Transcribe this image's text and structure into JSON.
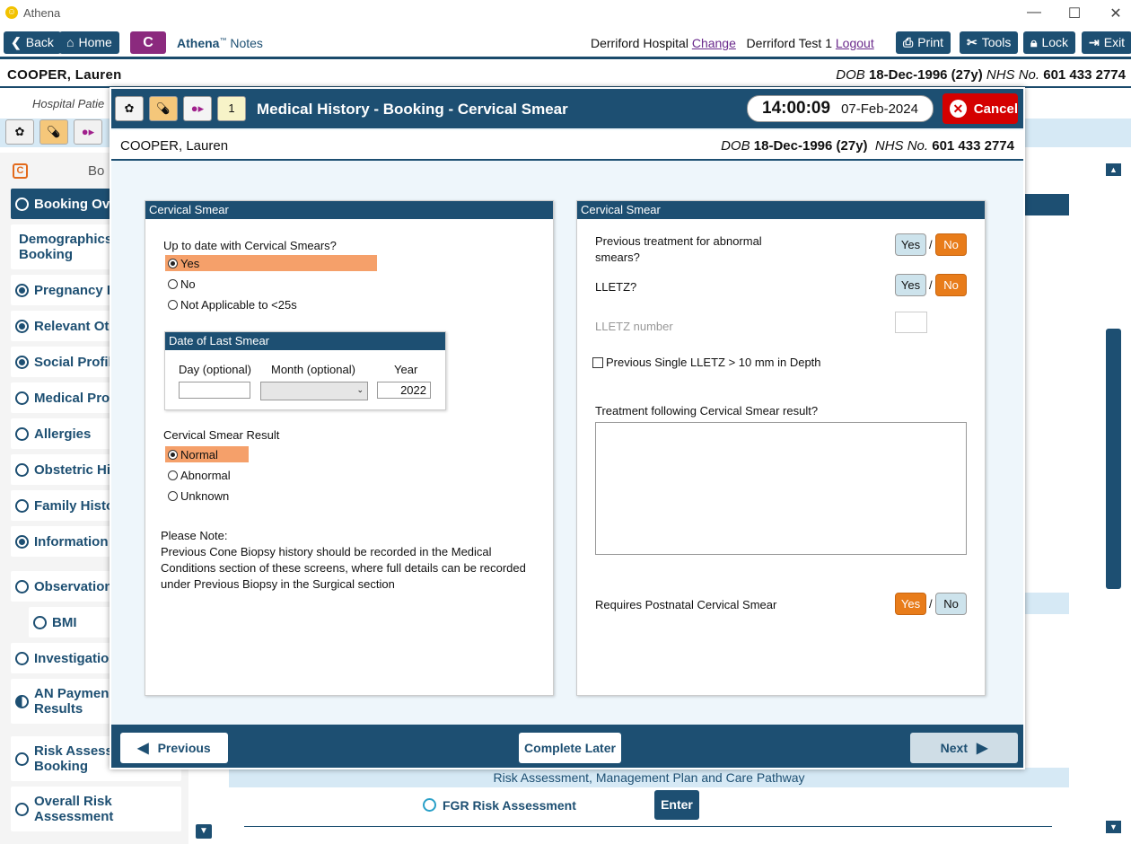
{
  "window": {
    "title": "Athena",
    "logo_glyph": "☺"
  },
  "toolbar": {
    "back": "Back",
    "home": "Home",
    "c_label": "C",
    "app_name": "Athena",
    "app_tm": "™",
    "app_sub": "Notes",
    "hospital": "Derriford Hospital",
    "change": "Change",
    "user": "Derriford Test 1",
    "logout": "Logout",
    "print": "Print",
    "tools": "Tools",
    "lock": "Lock",
    "exit": "Exit"
  },
  "patient": {
    "name": "COOPER, Lauren",
    "dob_label": "DOB",
    "dob": "18-Dec-1996 (27y)",
    "nhs_label": "NHS No.",
    "nhs": "601 433 2774"
  },
  "subbar": {
    "text": "Hospital Patie"
  },
  "sidebar": {
    "c_icon": "C",
    "header_partial": "Bo",
    "items": [
      {
        "label": "Booking Ov",
        "state": "empty"
      },
      {
        "label": "Demographics Booking",
        "state": "none"
      },
      {
        "label": "Pregnancy F",
        "state": "filled"
      },
      {
        "label": "Relevant Oth",
        "state": "filled"
      },
      {
        "label": "Social Profil",
        "state": "filled"
      },
      {
        "label": "Medical Pro",
        "state": "empty"
      },
      {
        "label": "Allergies",
        "state": "empty"
      },
      {
        "label": "Obstetric Hi",
        "state": "empty"
      },
      {
        "label": "Family Histo",
        "state": "empty"
      },
      {
        "label": "Information",
        "state": "filled"
      },
      {
        "label": "Observation",
        "state": "empty"
      },
      {
        "label": "BMI",
        "state": "empty"
      },
      {
        "label": "Investigatio",
        "state": "empty"
      },
      {
        "label": "AN Paymen Results",
        "state": "half"
      },
      {
        "label": "Risk Assess Booking",
        "state": "empty"
      },
      {
        "label": "Overall Risk Assessment",
        "state": "empty"
      }
    ]
  },
  "main": {
    "risk_header": "Risk Assessment, Management Plan and Care Pathway",
    "fgr": "FGR Risk Assessment",
    "enter": "Enter"
  },
  "modal": {
    "title": "Medical History - Booking - Cervical Smear",
    "time": "14:00:09",
    "date": "07-Feb-2024",
    "cancel": "Cancel",
    "cal_icon": "1",
    "left": {
      "header": "Cervical Smear",
      "q1": "Up to date with Cervical Smears?",
      "q1_options": [
        "Yes",
        "No",
        "Not Applicable to <25s"
      ],
      "q1_selected": "Yes",
      "date_header": "Date of Last Smear",
      "day_label": "Day (optional)",
      "month_label": "Month (optional)",
      "year_label": "Year",
      "day_value": "",
      "month_value": "",
      "year_value": "2022",
      "result_label": "Cervical Smear Result",
      "result_options": [
        "Normal",
        "Abnormal",
        "Unknown"
      ],
      "result_selected": "Normal",
      "note_title": "Please Note:",
      "note_lines": [
        "Previous Cone Biopsy history should be recorded in the Medical",
        "Conditions section of these screens, where full details can be recorded",
        "under Previous Biopsy in the Surgical section"
      ]
    },
    "right": {
      "header": "Cervical Smear",
      "prev_treatment_l1": "Previous treatment for abnormal",
      "prev_treatment_l2": "smears?",
      "prev_treatment_value": "No",
      "lletz": "LLETZ?",
      "lletz_value": "No",
      "lletz_number": "LLETZ number",
      "lletz_depth": "Previous Single LLETZ > 10 mm in Depth",
      "treatment_following": "Treatment following Cervical Smear result?",
      "postnatal": "Requires Postnatal Cervical Smear",
      "postnatal_value": "Yes",
      "yes": "Yes",
      "no": "No",
      "slash": "/"
    },
    "footer": {
      "previous": "Previous",
      "complete_later": "Complete Later",
      "next": "Next"
    }
  }
}
